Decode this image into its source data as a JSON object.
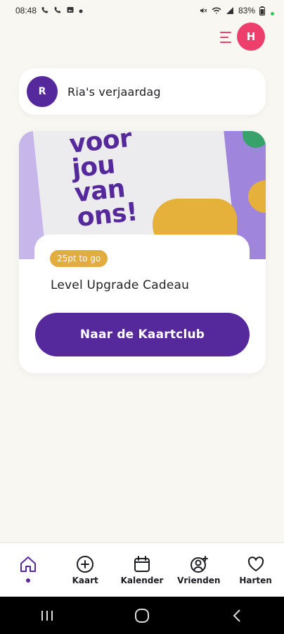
{
  "status_bar": {
    "time": "08:48",
    "battery": "83%"
  },
  "header": {
    "avatar_initial": "H",
    "accent_color": "#ec3f6b"
  },
  "event": {
    "avatar_initial": "R",
    "title": "Ria's verjaardag"
  },
  "reward_card": {
    "banner_lines": [
      "voor",
      "jou",
      "van",
      "ons!"
    ],
    "points_badge": "25pt to go",
    "title": "Level Upgrade Cadeau",
    "button_label": "Naar de Kaartclub"
  },
  "bottom_nav": {
    "items": [
      {
        "label": "",
        "icon": "home-icon",
        "active": true
      },
      {
        "label": "Kaart",
        "icon": "plus-circle-icon"
      },
      {
        "label": "Kalender",
        "icon": "calendar-icon"
      },
      {
        "label": "Vrienden",
        "icon": "add-friend-icon"
      },
      {
        "label": "Harten",
        "icon": "heart-icon"
      }
    ]
  },
  "colors": {
    "primary": "#55289c",
    "background": "#f9f7f2",
    "badge": "#e3ac3f"
  }
}
